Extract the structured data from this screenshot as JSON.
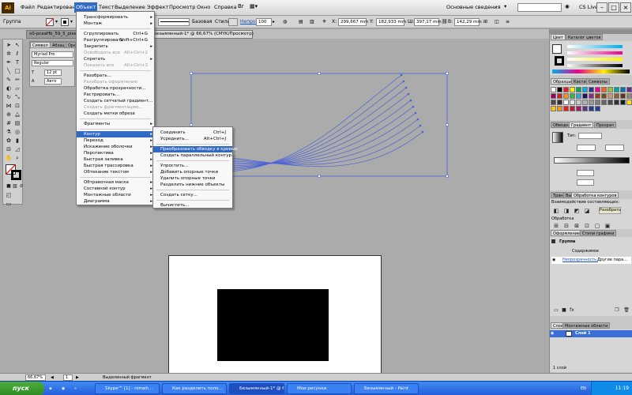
{
  "app": {
    "logo": "Ai"
  },
  "menubar": {
    "items": [
      "Файл",
      "Редактирование",
      "Объект",
      "Текст",
      "Выделение",
      "Эффект",
      "Просмотр",
      "Окно",
      "Справка"
    ],
    "workspace": "Основные сведения",
    "cs_live": "CS Live"
  },
  "controlbar": {
    "selection_label": "Группа",
    "stroke_style": "Базовая",
    "style_label": "Стиль:",
    "opacity_label": "Непрозр.:",
    "opacity_value": "100",
    "x_label": "X:",
    "x_value": "299,667 mm",
    "y_label": "Y:",
    "y_value": "182,933 mm",
    "w_label": "Ш:",
    "w_value": "397,17 mm",
    "h_label": "В:",
    "h_value": "142,29 mm"
  },
  "doc_tabs": [
    {
      "label": "x0-pcaaHb_59_5_pixel_a..."
    },
    {
      "label": "Безымянный-1* @ 66,67% (CMYK/Просмотр)"
    }
  ],
  "char_panel": {
    "tabs": [
      "Символ",
      "Абзац",
      "Opent"
    ],
    "font": "Myriad Pro",
    "style": "Regular",
    "size": "12 pt",
    "leading": "Авто"
  },
  "object_menu": {
    "items": [
      {
        "label": "Трансформировать",
        "arrow": true
      },
      {
        "label": "Монтаж",
        "arrow": true
      },
      {
        "sep": true
      },
      {
        "label": "Сгруппировать",
        "shortcut": "Ctrl+G"
      },
      {
        "label": "Разгруппировать",
        "shortcut": "Shift+Ctrl+G"
      },
      {
        "label": "Закрепить",
        "arrow": true
      },
      {
        "label": "Освободить все",
        "shortcut": "Alt+Ctrl+2",
        "disabled": true
      },
      {
        "label": "Спрятать",
        "arrow": true
      },
      {
        "label": "Показать все",
        "shortcut": "Alt+Ctrl+3",
        "disabled": true
      },
      {
        "sep": true
      },
      {
        "label": "Разобрать..."
      },
      {
        "label": "Разобрать оформление",
        "disabled": true
      },
      {
        "label": "Обработка прозрачности..."
      },
      {
        "label": "Растрировать..."
      },
      {
        "label": "Создать сетчатый градиент..."
      },
      {
        "label": "Создать фрагментацию...",
        "disabled": true
      },
      {
        "label": "Создать метки обреза"
      },
      {
        "sep": true
      },
      {
        "label": "Фрагменты",
        "arrow": true
      },
      {
        "sep": true
      },
      {
        "label": "Контур",
        "arrow": true,
        "selected": true
      },
      {
        "label": "Переход",
        "arrow": true
      },
      {
        "label": "Искажение оболочки",
        "arrow": true
      },
      {
        "label": "Перспектива",
        "arrow": true
      },
      {
        "label": "Быстрая заливка",
        "arrow": true
      },
      {
        "label": "Быстрая трассировка",
        "arrow": true
      },
      {
        "label": "Обтекание текстом",
        "arrow": true
      },
      {
        "sep": true
      },
      {
        "label": "Обтравочная маска",
        "arrow": true
      },
      {
        "label": "Составной контур",
        "arrow": true
      },
      {
        "label": "Монтажные области",
        "arrow": true
      },
      {
        "label": "Диаграмма",
        "arrow": true
      }
    ]
  },
  "path_submenu": {
    "items": [
      {
        "label": "Соединить",
        "shortcut": "Ctrl+J"
      },
      {
        "label": "Усреднить...",
        "shortcut": "Alt+Ctrl+J"
      },
      {
        "sep": true
      },
      {
        "label": "Преобразовать обводку в кривые",
        "selected": true
      },
      {
        "label": "Создать параллельный контур..."
      },
      {
        "sep": true
      },
      {
        "label": "Упростить..."
      },
      {
        "label": "Добавить опорные точки"
      },
      {
        "label": "Удалить опорные точки"
      },
      {
        "label": "Разделить нижние объекты"
      },
      {
        "sep": true
      },
      {
        "label": "Создать сетку..."
      },
      {
        "sep": true
      },
      {
        "label": "Вычистить..."
      }
    ]
  },
  "right_panels": {
    "color": {
      "tabs": [
        "Цвет",
        "Каталог цветов"
      ]
    },
    "swatches": {
      "tabs": [
        "Образцы",
        "Кисти",
        "Символы"
      ]
    },
    "gradient": {
      "tabs": [
        "Обводка",
        "Градиент",
        "Прозрач"
      ],
      "type_label": "Тип:"
    },
    "pathfinder": {
      "tabs": [
        "Трансф",
        "Выр",
        "Обработка контуров"
      ],
      "shape_modes": "Взаимодействие составляющих:",
      "expand": "Разобрать",
      "pathfinders": "Обработка"
    },
    "appearance": {
      "tabs": [
        "Оформление",
        "Стили графики"
      ],
      "group": "Группа",
      "contents": "Содержимое",
      "opacity": "Непрозрачность:",
      "opacity_value": "Другие пара..."
    },
    "layers": {
      "tabs": [
        "Слои",
        "Монтажные области"
      ],
      "layer": "Слой 1",
      "count": "1 слой"
    }
  },
  "statusbar": {
    "zoom": "66,67%",
    "page": "1",
    "mode": "Выделенный фрагмент"
  },
  "taskbar": {
    "start": "пуск",
    "items": [
      {
        "label": "Skype™ [1] - romeh..."
      },
      {
        "label": "Как разделить поло..."
      },
      {
        "label": "Безымянный-1* @ 6...",
        "active": true
      },
      {
        "label": "Мои рисунки"
      },
      {
        "label": "Безымянный - Paint"
      }
    ],
    "lang": "EN",
    "time": "11:19"
  }
}
